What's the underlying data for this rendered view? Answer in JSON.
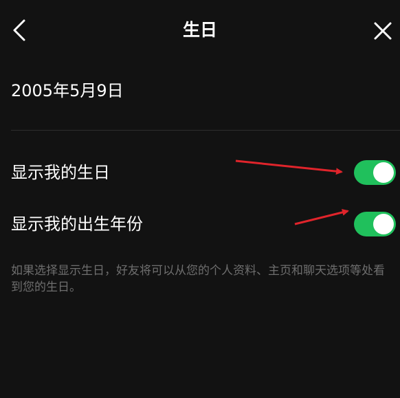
{
  "header": {
    "title": "生日",
    "back_icon": "chevron-left-icon",
    "close_icon": "close-icon"
  },
  "birthday": {
    "date": "2005年5月9日"
  },
  "settings": [
    {
      "label": "显示我的生日",
      "enabled": true
    },
    {
      "label": "显示我的出生年份",
      "enabled": true
    }
  ],
  "hint": "如果选择显示生日，好友将可以从您的个人资料、主页和聊天选项等处看到您的生日。",
  "colors": {
    "background": "#121212",
    "toggle_on": "#20c05c",
    "hint_text": "#6e6e6e",
    "annotation_arrow": "#e0242b"
  }
}
